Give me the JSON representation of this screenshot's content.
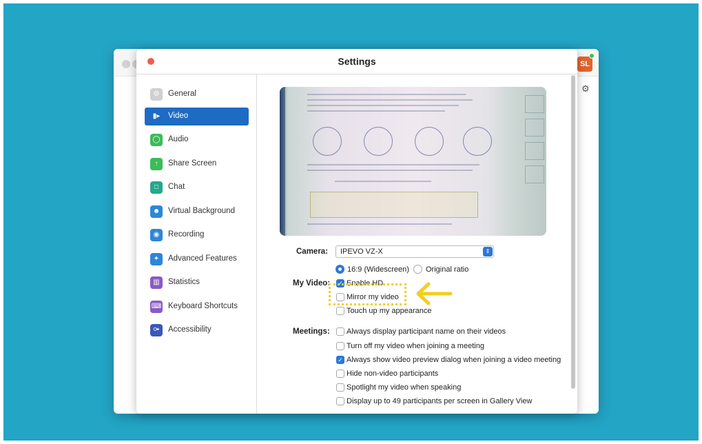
{
  "app": {
    "avatar_initials": "SL"
  },
  "dialog": {
    "title": "Settings"
  },
  "sidebar": {
    "items": [
      {
        "label": "General",
        "icon": "gear-icon",
        "color": "#d0d0d0",
        "selected": false
      },
      {
        "label": "Video",
        "icon": "video-camera-icon",
        "color": "#1e6bc4",
        "selected": true
      },
      {
        "label": "Audio",
        "icon": "headphones-icon",
        "color": "#3cbb5a",
        "selected": false
      },
      {
        "label": "Share Screen",
        "icon": "share-screen-icon",
        "color": "#3cbb5a",
        "selected": false
      },
      {
        "label": "Chat",
        "icon": "chat-bubble-icon",
        "color": "#26a88c",
        "selected": false
      },
      {
        "label": "Virtual Background",
        "icon": "user-portrait-icon",
        "color": "#2d86d8",
        "selected": false
      },
      {
        "label": "Recording",
        "icon": "record-icon",
        "color": "#2d86d8",
        "selected": false
      },
      {
        "label": "Advanced Features",
        "icon": "sparkles-icon",
        "color": "#2d86d8",
        "selected": false
      },
      {
        "label": "Statistics",
        "icon": "bar-chart-icon",
        "color": "#8a5bc4",
        "selected": false
      },
      {
        "label": "Keyboard Shortcuts",
        "icon": "keyboard-icon",
        "color": "#8a5bc4",
        "selected": false
      },
      {
        "label": "Accessibility",
        "icon": "accessibility-icon",
        "color": "#3a58b8",
        "selected": false
      }
    ]
  },
  "video": {
    "camera_label": "Camera:",
    "camera_value": "IPEVO VZ-X",
    "aspect_options": [
      {
        "label": "16:9 (Widescreen)",
        "selected": true
      },
      {
        "label": "Original ratio",
        "selected": false
      }
    ],
    "my_video_label": "My Video:",
    "my_video_options": [
      {
        "label": "Enable HD",
        "checked": true
      },
      {
        "label": "Mirror my video",
        "checked": false
      },
      {
        "label": "Touch up my appearance",
        "checked": false
      }
    ],
    "meetings_label": "Meetings:",
    "meetings_options": [
      {
        "label": "Always display participant name on their videos",
        "checked": false
      },
      {
        "label": "Turn off my video when joining a meeting",
        "checked": false
      },
      {
        "label": "Always show video preview dialog when joining a video meeting",
        "checked": true
      },
      {
        "label": "Hide non-video participants",
        "checked": false
      },
      {
        "label": "Spotlight my video when speaking",
        "checked": false
      },
      {
        "label": "Display up to 49 participants per screen in Gallery View",
        "checked": false
      }
    ]
  },
  "colors": {
    "accent": "#2d77d8",
    "background": "#23a5c6",
    "highlight": "#f1cf1d"
  }
}
